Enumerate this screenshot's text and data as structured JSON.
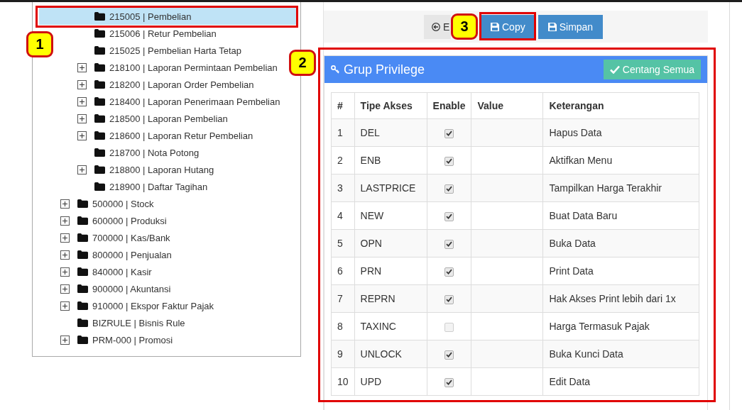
{
  "tree": {
    "items": [
      {
        "children": [
          {
            "label": "215005 | Pembelian",
            "expandable": false,
            "selected": true
          },
          {
            "label": "215006 | Retur Pembelian",
            "expandable": false,
            "selected": false
          },
          {
            "label": "215025 | Pembelian Harta Tetap",
            "expandable": false,
            "selected": false
          },
          {
            "label": "218100 | Laporan Permintaan Pembelian",
            "expandable": true,
            "selected": false
          },
          {
            "label": "218200 | Laporan Order Pembelian",
            "expandable": true,
            "selected": false
          },
          {
            "label": "218400 | Laporan Penerimaan Pembelian",
            "expandable": true,
            "selected": false
          },
          {
            "label": "218500 | Laporan Pembelian",
            "expandable": true,
            "selected": false
          },
          {
            "label": "218600 | Laporan Retur Pembelian",
            "expandable": true,
            "selected": false
          },
          {
            "label": "218700 | Nota Potong",
            "expandable": false,
            "selected": false
          },
          {
            "label": "218800 | Laporan Hutang",
            "expandable": true,
            "selected": false
          },
          {
            "label": "218900 | Daftar Tagihan",
            "expandable": false,
            "selected": false
          }
        ]
      },
      {
        "label": "500000 | Stock",
        "expandable": true,
        "selected": false
      },
      {
        "label": "600000 | Produksi",
        "expandable": true,
        "selected": false
      },
      {
        "label": "700000 | Kas/Bank",
        "expandable": true,
        "selected": false
      },
      {
        "label": "800000 | Penjualan",
        "expandable": true,
        "selected": false
      },
      {
        "label": "840000 | Kasir",
        "expandable": true,
        "selected": false
      },
      {
        "label": "900000 | Akuntansi",
        "expandable": true,
        "selected": false
      },
      {
        "label": "910000 | Ekspor Faktur Pajak",
        "expandable": true,
        "selected": false
      },
      {
        "label": "BIZRULE | Bisnis Rule",
        "expandable": false,
        "selected": false
      },
      {
        "label": "PRM-000 | Promosi",
        "expandable": true,
        "selected": false
      }
    ]
  },
  "toolbar": {
    "buttons": [
      {
        "kind": "back",
        "label": "E"
      },
      {
        "kind": "save",
        "label": "Copy"
      },
      {
        "kind": "save",
        "label": "Simpan"
      }
    ]
  },
  "panel": {
    "title": "Grup Privilege",
    "action": "Centang Semua",
    "table": {
      "columns": [
        "#",
        "Tipe Akses",
        "Enable",
        "Value",
        "Keterangan"
      ],
      "rows": [
        {
          "no": "1",
          "type": "DEL",
          "enabled": true,
          "description": "Hapus Data"
        },
        {
          "no": "2",
          "type": "ENB",
          "enabled": true,
          "description": "Aktifkan Menu"
        },
        {
          "no": "3",
          "type": "LASTPRICE",
          "enabled": true,
          "description": "Tampilkan Harga Terakhir"
        },
        {
          "no": "4",
          "type": "NEW",
          "enabled": true,
          "description": "Buat Data Baru"
        },
        {
          "no": "5",
          "type": "OPN",
          "enabled": true,
          "description": "Buka Data"
        },
        {
          "no": "6",
          "type": "PRN",
          "enabled": true,
          "description": "Print Data"
        },
        {
          "no": "7",
          "type": "REPRN",
          "enabled": true,
          "description": "Hak Akses Print lebih dari 1x"
        },
        {
          "no": "8",
          "type": "TAXINC",
          "enabled": false,
          "description": "Harga Termasuk Pajak"
        },
        {
          "no": "9",
          "type": "UNLOCK",
          "enabled": true,
          "description": "Buka Kunci Data"
        },
        {
          "no": "10",
          "type": "UPD",
          "enabled": true,
          "description": "Edit Data"
        }
      ]
    }
  },
  "annotations": [
    {
      "label": "1"
    },
    {
      "label": "2"
    },
    {
      "label": "3"
    }
  ]
}
